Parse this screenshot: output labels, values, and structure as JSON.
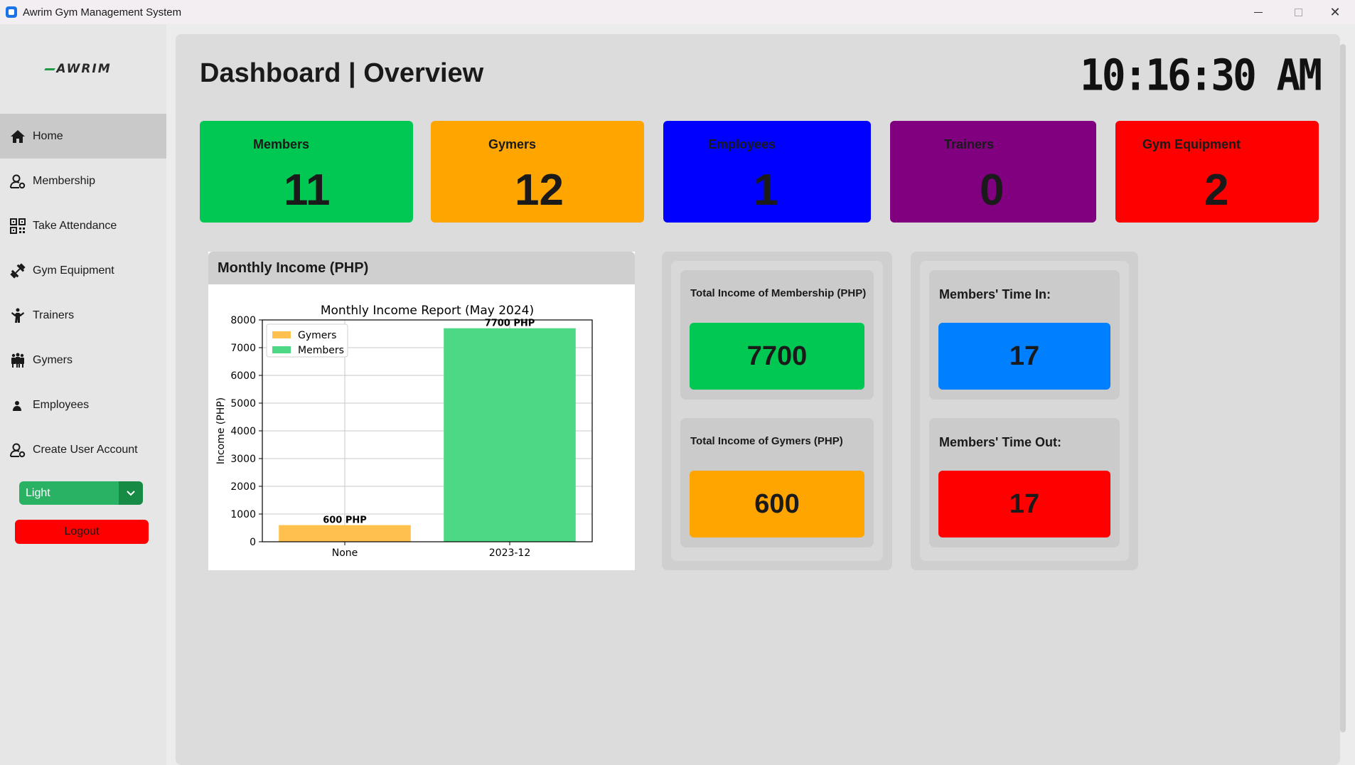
{
  "window": {
    "title": "Awrim Gym Management System"
  },
  "sidebar": {
    "logo_text": "AWRIM",
    "items": [
      {
        "label": "Home",
        "icon": "home-icon"
      },
      {
        "label": "Membership",
        "icon": "user-gear-icon"
      },
      {
        "label": "Take Attendance",
        "icon": "qr-code-icon"
      },
      {
        "label": "Gym Equipment",
        "icon": "dumbbell-icon"
      },
      {
        "label": "Trainers",
        "icon": "trainer-icon"
      },
      {
        "label": "Gymers",
        "icon": "group-icon"
      },
      {
        "label": "Employees",
        "icon": "employee-icon"
      },
      {
        "label": "Create User Account",
        "icon": "user-add-icon"
      }
    ],
    "theme_value": "Light",
    "logout_label": "Logout"
  },
  "header": {
    "title": "Dashboard | Overview",
    "clock": "10:16:30 AM"
  },
  "stats": [
    {
      "label": "Members",
      "value": "11",
      "color": "#00c853"
    },
    {
      "label": "Gymers",
      "value": "12",
      "color": "#ffa500"
    },
    {
      "label": "Employees",
      "value": "1",
      "color": "#0000ff"
    },
    {
      "label": "Trainers",
      "value": "0",
      "color": "#800080"
    },
    {
      "label": "Gym Equipment",
      "value": "2",
      "color": "#ff0000"
    }
  ],
  "income_panel": {
    "title": "Monthly Income (PHP)"
  },
  "chart_data": {
    "type": "bar",
    "title": "Monthly Income Report (May 2024)",
    "xlabel": "",
    "ylabel": "Income (PHP)",
    "ylim": [
      0,
      8000
    ],
    "yticks": [
      0,
      1000,
      2000,
      3000,
      4000,
      5000,
      6000,
      7000,
      8000
    ],
    "categories": [
      "None",
      "2023-12"
    ],
    "series": [
      {
        "name": "Gymers",
        "color": "#ffc04d",
        "values": [
          600,
          null
        ],
        "labels": [
          "600 PHP",
          ""
        ]
      },
      {
        "name": "Members",
        "color": "#4cd884",
        "values": [
          null,
          7700
        ],
        "labels": [
          "",
          "7700 PHP"
        ]
      }
    ],
    "grid": true,
    "legend": "top-left"
  },
  "income_totals": [
    {
      "label": "Total Income of Membership (PHP)",
      "value": "7700",
      "color": "#00c853"
    },
    {
      "label": "Total Income of Gymers (PHP)",
      "value": "600",
      "color": "#ffa500"
    }
  ],
  "attendance": [
    {
      "label": "Members' Time In:",
      "value": "17",
      "color": "#0080ff"
    },
    {
      "label": "Members' Time Out:",
      "value": "17",
      "color": "#ff0000"
    }
  ]
}
